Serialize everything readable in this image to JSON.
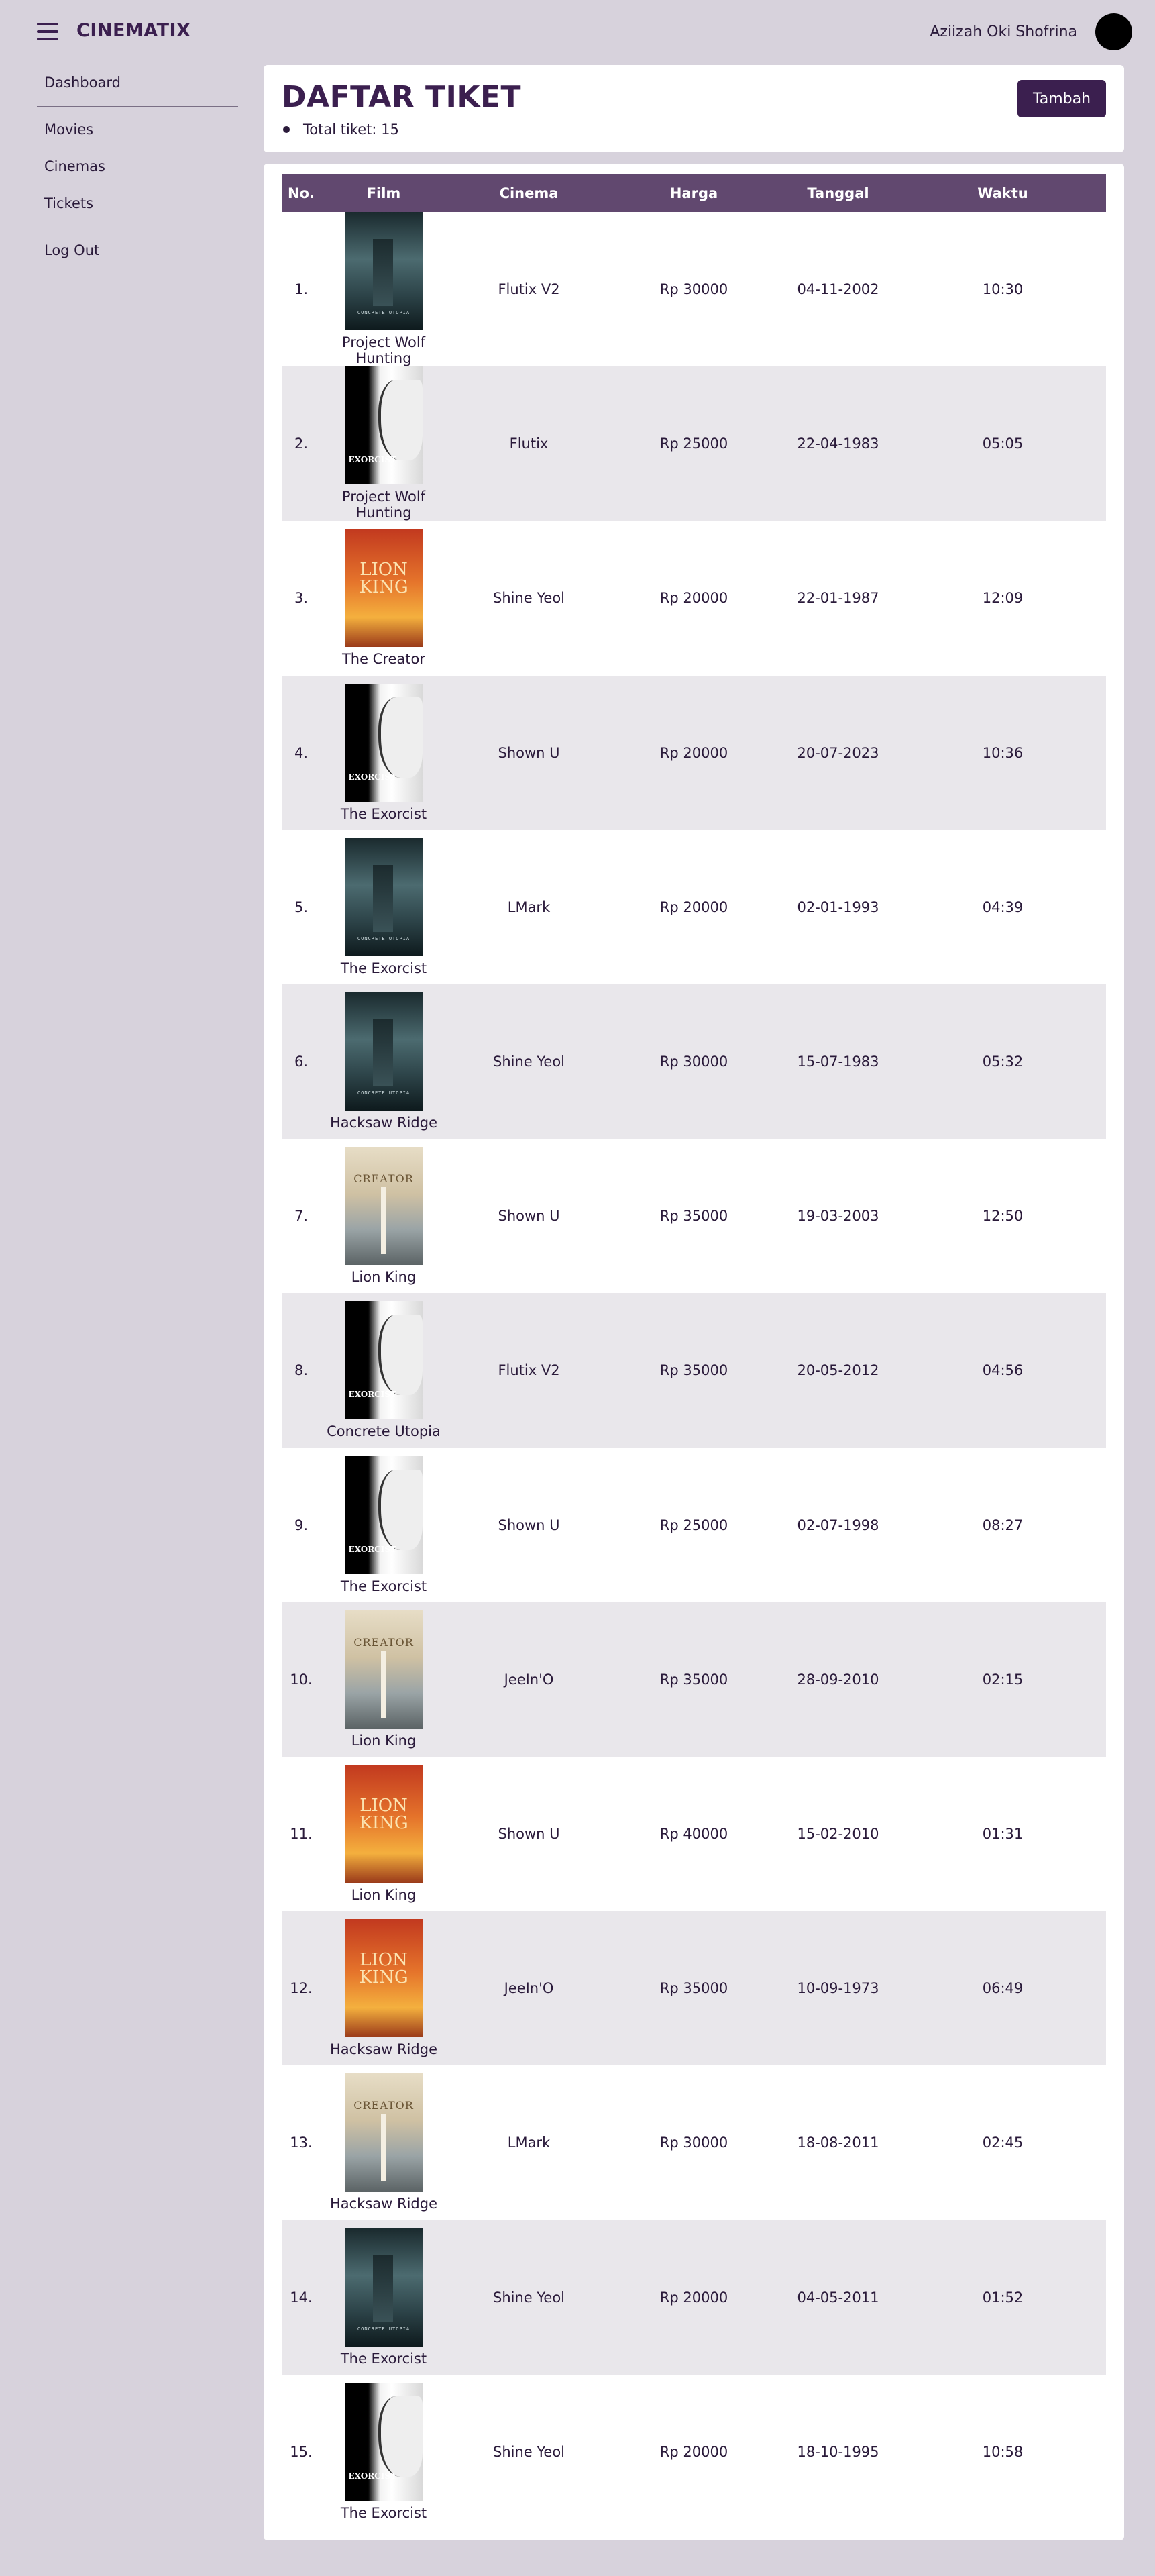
{
  "app": {
    "brand": "CINEMATIX",
    "user_name": "Aziizah Oki Shofrina"
  },
  "sidebar": {
    "items": [
      {
        "label": "Dashboard"
      },
      {
        "label": "Movies"
      },
      {
        "label": "Cinemas"
      },
      {
        "label": "Tickets"
      },
      {
        "label": "Log Out"
      }
    ]
  },
  "header": {
    "title": "DAFTAR TIKET",
    "total_text": "Total tiket: 15",
    "add_label": "Tambah"
  },
  "table": {
    "columns": [
      "No.",
      "Film",
      "Cinema",
      "Harga",
      "Tanggal",
      "Waktu"
    ],
    "rows": [
      {
        "no": "1.",
        "poster": "concrete-utopia-poster",
        "film": "Project Wolf Hunting",
        "cinema": "Flutix V2",
        "harga": "Rp 30000",
        "tanggal": "04-11-2002",
        "waktu": "10:30"
      },
      {
        "no": "2.",
        "poster": "exorcist-poster",
        "film": "Project Wolf Hunting",
        "cinema": "Flutix",
        "harga": "Rp 25000",
        "tanggal": "22-04-1983",
        "waktu": "05:05"
      },
      {
        "no": "3.",
        "poster": "lion-king-poster",
        "film": "The Creator",
        "cinema": "Shine Yeol",
        "harga": "Rp 20000",
        "tanggal": "22-01-1987",
        "waktu": "12:09"
      },
      {
        "no": "4.",
        "poster": "exorcist-poster",
        "film": "The Exorcist",
        "cinema": "Shown U",
        "harga": "Rp 20000",
        "tanggal": "20-07-2023",
        "waktu": "10:36"
      },
      {
        "no": "5.",
        "poster": "concrete-utopia-poster",
        "film": "The Exorcist",
        "cinema": "LMark",
        "harga": "Rp 20000",
        "tanggal": "02-01-1993",
        "waktu": "04:39"
      },
      {
        "no": "6.",
        "poster": "concrete-utopia-poster",
        "film": "Hacksaw Ridge",
        "cinema": "Shine Yeol",
        "harga": "Rp 30000",
        "tanggal": "15-07-1983",
        "waktu": "05:32"
      },
      {
        "no": "7.",
        "poster": "creator-poster",
        "film": "Lion King",
        "cinema": "Shown U",
        "harga": "Rp 35000",
        "tanggal": "19-03-2003",
        "waktu": "12:50"
      },
      {
        "no": "8.",
        "poster": "exorcist-poster",
        "film": "Concrete Utopia",
        "cinema": "Flutix V2",
        "harga": "Rp 35000",
        "tanggal": "20-05-2012",
        "waktu": "04:56"
      },
      {
        "no": "9.",
        "poster": "exorcist-poster",
        "film": "The Exorcist",
        "cinema": "Shown U",
        "harga": "Rp 25000",
        "tanggal": "02-07-1998",
        "waktu": "08:27"
      },
      {
        "no": "10.",
        "poster": "creator-poster",
        "film": "Lion King",
        "cinema": "JeeIn'O",
        "harga": "Rp 35000",
        "tanggal": "28-09-2010",
        "waktu": "02:15"
      },
      {
        "no": "11.",
        "poster": "lion-king-poster",
        "film": "Lion King",
        "cinema": "Shown U",
        "harga": "Rp 40000",
        "tanggal": "15-02-2010",
        "waktu": "01:31"
      },
      {
        "no": "12.",
        "poster": "lion-king-poster",
        "film": "Hacksaw Ridge",
        "cinema": "JeeIn'O",
        "harga": "Rp 35000",
        "tanggal": "10-09-1973",
        "waktu": "06:49"
      },
      {
        "no": "13.",
        "poster": "creator-poster",
        "film": "Hacksaw Ridge",
        "cinema": "LMark",
        "harga": "Rp 30000",
        "tanggal": "18-08-2011",
        "waktu": "02:45"
      },
      {
        "no": "14.",
        "poster": "concrete-utopia-poster",
        "film": "The Exorcist",
        "cinema": "Shine Yeol",
        "harga": "Rp 20000",
        "tanggal": "04-05-2011",
        "waktu": "01:52"
      },
      {
        "no": "15.",
        "poster": "exorcist-poster",
        "film": "The Exorcist",
        "cinema": "Shine Yeol",
        "harga": "Rp 20000",
        "tanggal": "18-10-1995",
        "waktu": "10:58"
      }
    ]
  },
  "poster_text": {
    "concrete-utopia-poster": "CONCRETE UTOPIA",
    "exorcist-poster": "EXORCIST",
    "lion-king-poster": "LION KING",
    "creator-poster": "CREATOR"
  },
  "colors": {
    "accent": "#3b1f4f",
    "table_header": "#61486f",
    "background": "#d7d2dc"
  }
}
